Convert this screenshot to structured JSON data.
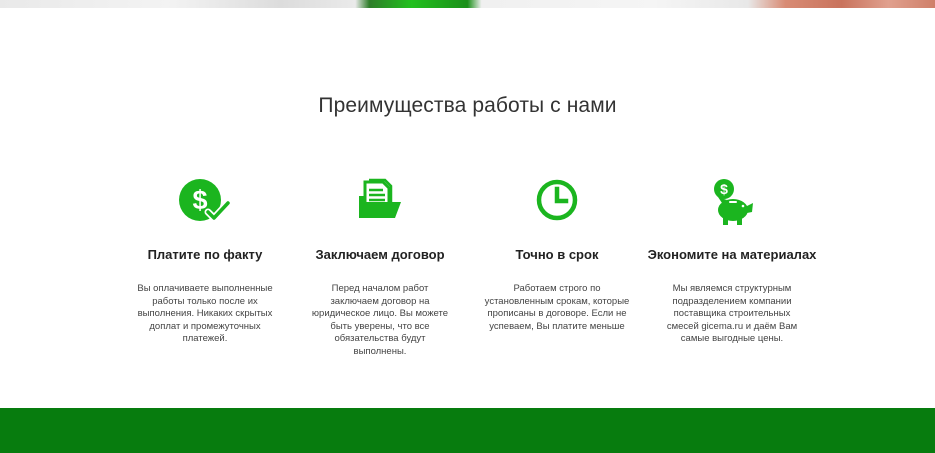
{
  "section": {
    "title": "Преимущества работы с нами"
  },
  "features": [
    {
      "icon": "dollar-check-icon",
      "title": "Платите по факту",
      "text": "Вы оплачиваете выполненные работы только после их выполнения. Никаких скрытых доплат и промежуточных платежей."
    },
    {
      "icon": "contract-folder-icon",
      "title": "Заключаем договор",
      "text": "Перед началом работ заключаем договор на юридическое лицо. Вы можете быть уверены, что все обязательства будут выполнены."
    },
    {
      "icon": "clock-icon",
      "title": "Точно в срок",
      "text": "Работаем строго по установленным срокам, которые прописаны в договоре. Если не успеваем, Вы платите меньше"
    },
    {
      "icon": "piggy-bank-icon",
      "title": "Экономите на материалах",
      "text": "Мы являемся структурным подразделением компании поставщика строительных смесей gicema.ru и даём Вам самые выгодные цены."
    }
  ],
  "colors": {
    "accent": "#1bb51f",
    "footer_band": "#077c0e",
    "title_text": "#333333"
  }
}
